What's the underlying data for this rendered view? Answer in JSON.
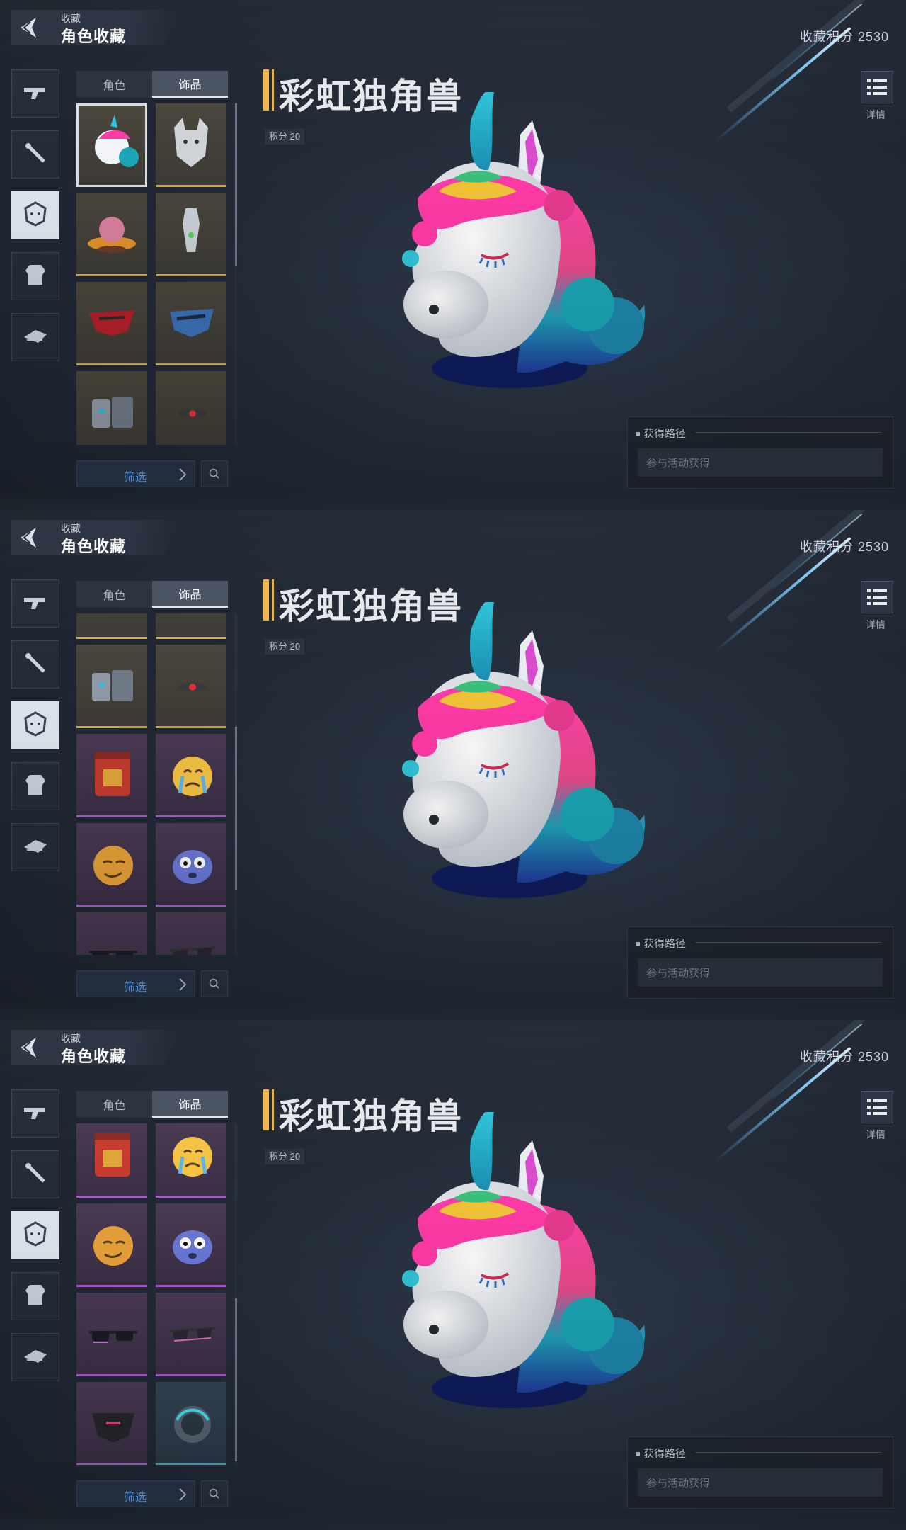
{
  "header": {
    "section": "收藏",
    "title": "角色收藏"
  },
  "collection_points": "收藏积分 2530",
  "categories": [
    {
      "name": "weapon-gun"
    },
    {
      "name": "weapon-melee"
    },
    {
      "name": "avatar-head",
      "active": true
    },
    {
      "name": "armor"
    },
    {
      "name": "vehicle"
    }
  ],
  "tabs": [
    {
      "label": "角色"
    },
    {
      "label": "饰品"
    }
  ],
  "item": {
    "name": "彩虹独角兽",
    "points": "积分 20"
  },
  "details_label": "详情",
  "filter_label": "筛选",
  "acquire": {
    "title": "获得路径",
    "method": "参与活动获得"
  },
  "items": [
    {
      "icon": "unicorn-head",
      "rarity": "gold"
    },
    {
      "icon": "wolf-head",
      "rarity": "gold"
    },
    {
      "icon": "ufo-pig",
      "rarity": "gold"
    },
    {
      "icon": "silver-figure",
      "rarity": "gold"
    },
    {
      "icon": "red-visor",
      "rarity": "gold"
    },
    {
      "icon": "blue-visor",
      "rarity": "gold"
    },
    {
      "icon": "gauntlet",
      "rarity": "gold"
    },
    {
      "icon": "red-eye-device",
      "rarity": "gold"
    },
    {
      "icon": "red-backpack",
      "rarity": "purple"
    },
    {
      "icon": "crying-emoji",
      "rarity": "purple"
    },
    {
      "icon": "smirk-emoji",
      "rarity": "purple"
    },
    {
      "icon": "scared-blob",
      "rarity": "purple"
    },
    {
      "icon": "dark-glasses",
      "rarity": "purple"
    },
    {
      "icon": "pink-glasses",
      "rarity": "purple"
    },
    {
      "icon": "black-mask",
      "rarity": "purple"
    },
    {
      "icon": "cyan-ring",
      "rarity": "blue"
    }
  ],
  "screens": [
    {
      "scroll_offset_rows": 0
    },
    {
      "scroll_offset_rows": 2.65
    },
    {
      "scroll_offset_rows": 4.1
    }
  ],
  "colors": {
    "title_accent": "#f0b64a",
    "filter_text": "#5aa3ff",
    "rarity_gold": "#d6a63c",
    "rarity_purple": "#a65dc9",
    "rarity_blue": "#45a9c9"
  }
}
